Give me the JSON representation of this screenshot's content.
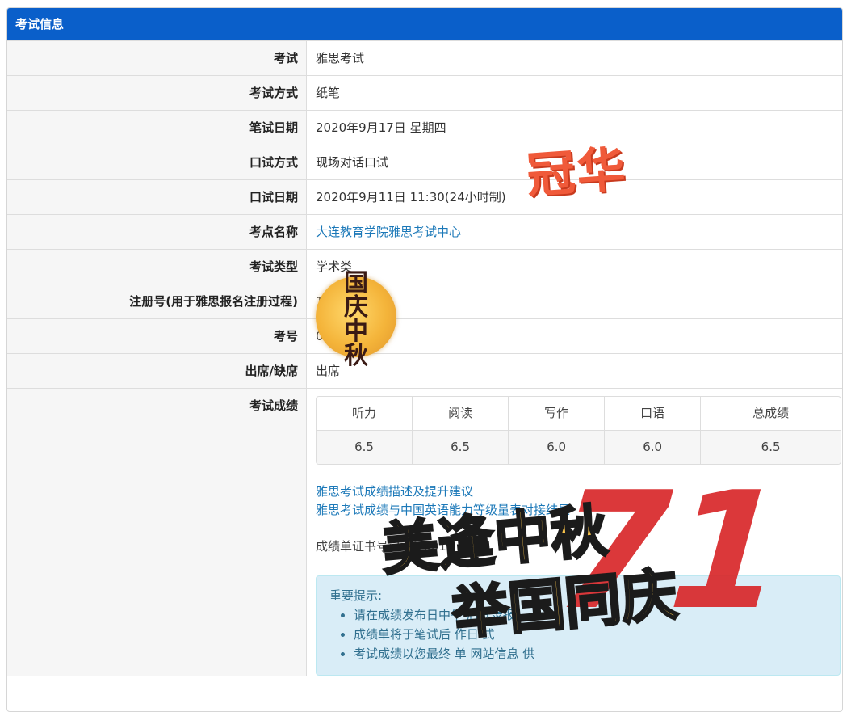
{
  "panel": {
    "title": "考试信息"
  },
  "rows": [
    {
      "label": "考试",
      "value": "雅思考试"
    },
    {
      "label": "考试方式",
      "value": "纸笔"
    },
    {
      "label": "笔试日期",
      "value": "2020年9月17日 星期四"
    },
    {
      "label": "口试方式",
      "value": "现场对话口试"
    },
    {
      "label": "口试日期",
      "value": "2020年9月11日 11:30(24小时制)"
    },
    {
      "label": "考点名称",
      "value": "大连教育学院雅思考试中心"
    },
    {
      "label": "考试类型",
      "value": "学术类"
    },
    {
      "label": "注册号(用于雅思报名注册过程)",
      "value": "1"
    },
    {
      "label": "考号",
      "value": "0"
    },
    {
      "label": "出席/缺席",
      "value": "出席"
    }
  ],
  "scores": {
    "label": "考试成绩",
    "headers": [
      "听力",
      "阅读",
      "写作",
      "口语",
      "总成绩"
    ],
    "values": [
      "6.5",
      "6.5",
      "6.0",
      "6.0",
      "6.5"
    ]
  },
  "links": [
    "雅思考试成绩描述及提升建议",
    "雅思考试成绩与中国英语能力等级量表对接结果"
  ],
  "certificate": {
    "label": "成绩单证书号:",
    "value": "502 001"
  },
  "notice": {
    "title": "重要提示:",
    "items": [
      "请在成绩发布日中午 后登录报",
      "成绩单将于笔试后 作日 式",
      "考试成绩以您最终 单 网站信息 供"
    ]
  },
  "overlays": {
    "stamp": "冠华",
    "badge": "国庆中秋",
    "slogan_line1": "美逢中秋",
    "slogan_line2": "举国同庆",
    "emblem": "71"
  }
}
